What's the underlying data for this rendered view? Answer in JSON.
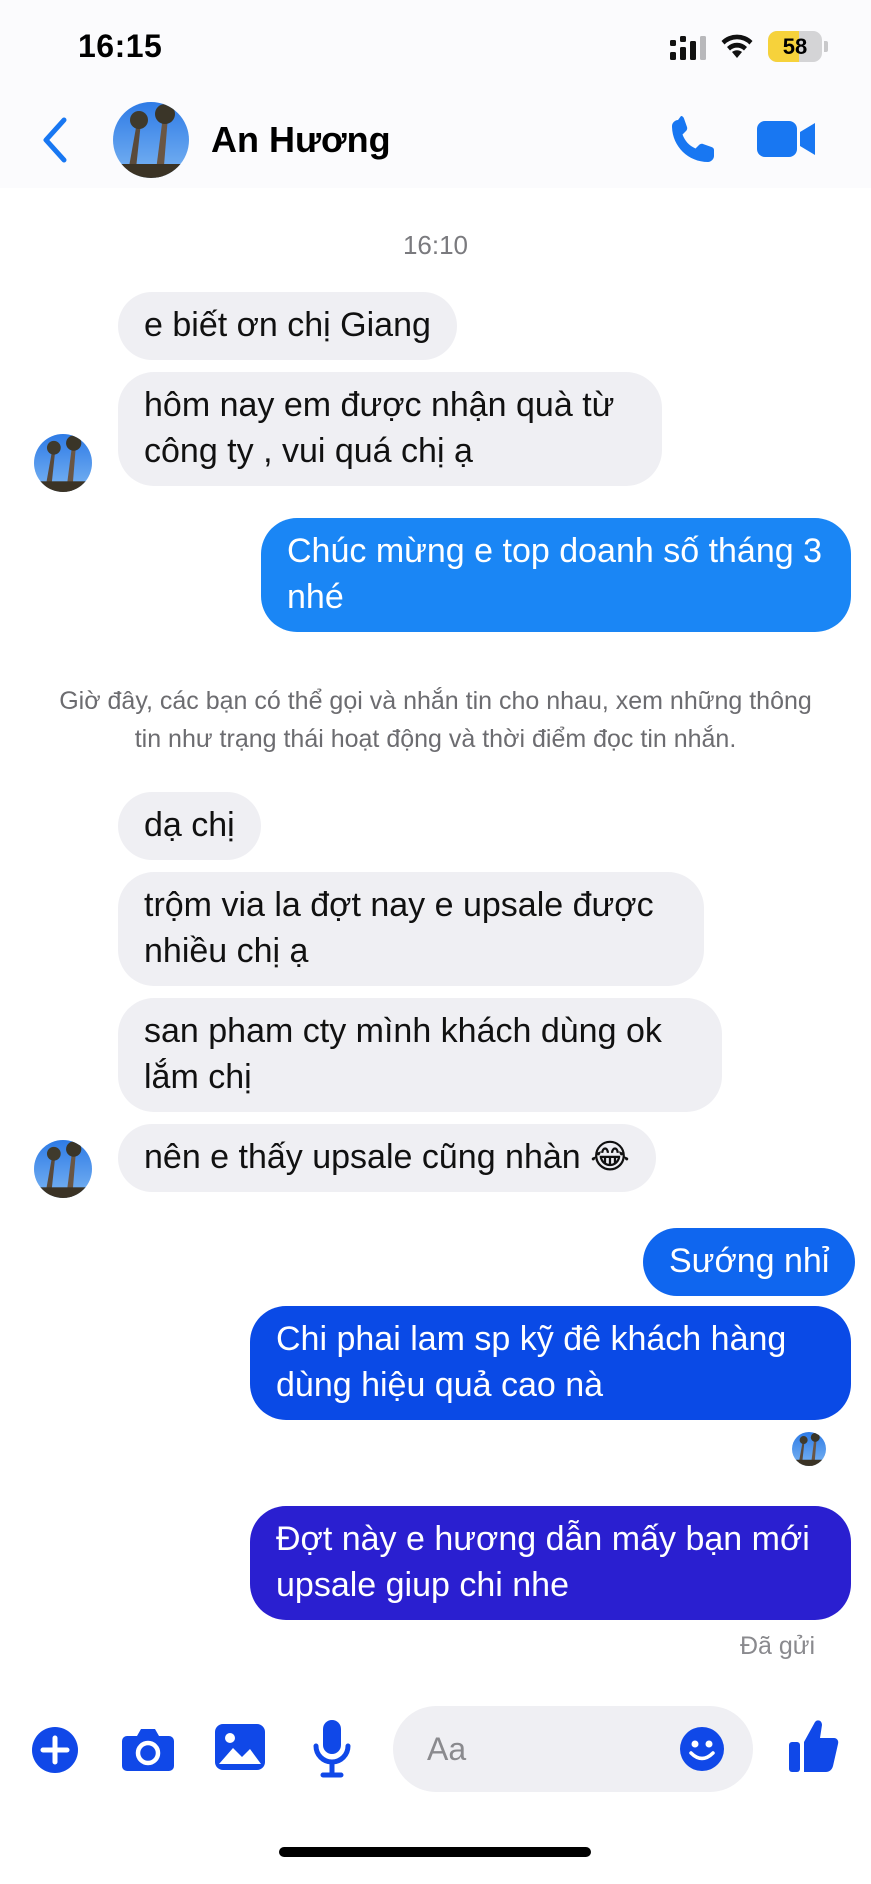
{
  "status_bar": {
    "time": "16:15",
    "battery_level": "58",
    "battery_fraction": 0.58,
    "icons": [
      "cellular-signal-icon",
      "wifi-icon",
      "battery-icon"
    ]
  },
  "header": {
    "contact_name": "An Hương",
    "icons": [
      "back-chevron-icon",
      "phone-icon",
      "video-camera-icon"
    ]
  },
  "colors": {
    "accent": "#1877f2",
    "incoming_bubble": "#efeff3",
    "outgoing_gradient": [
      "#1c8bf6",
      "#0a43e6",
      "#2a17c9"
    ]
  },
  "thread": {
    "timestamp": "16:10",
    "group1": [
      "e biết ơn chị Giang",
      "hôm nay em được nhận quà từ công ty , vui quá chị ạ"
    ],
    "out1": "Chúc mừng e top doanh số tháng 3 nhé",
    "notice": "Giờ đây, các bạn có thể gọi và nhắn tin cho nhau, xem những thông tin như trạng thái hoạt động và thời điểm đọc tin nhắn.",
    "group2": [
      "dạ chị",
      "trộm via la đợt nay e upsale được nhiều chị ạ",
      "san pham cty mình khách dùng ok lắm chị",
      "nên e thấy upsale cũng nhàn 😂"
    ],
    "out2": [
      "Sướng nhỉ",
      "Chi phai lam sp kỹ  đê khách hàng dùng hiệu quả cao nà"
    ],
    "out3": "Đợt này e hương dẫn mấy bạn mới upsale giup chi nhe",
    "sent_status": "Đã gửi"
  },
  "composer": {
    "placeholder": "Aa",
    "icons": [
      "plus-icon",
      "camera-icon",
      "image-icon",
      "microphone-icon",
      "emoji-icon",
      "thumbs-up-icon"
    ]
  }
}
